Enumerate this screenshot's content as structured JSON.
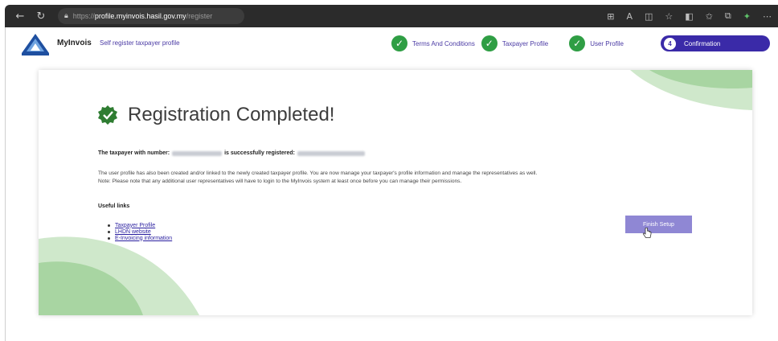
{
  "browser": {
    "url_scheme": "https://",
    "url_host": "profile.myinvois.hasil.gov.my",
    "url_path": "/register",
    "icons": [
      "back-icon",
      "refresh-icon",
      "lock-icon",
      "apps-icon",
      "read-aloud-icon",
      "split-screen-icon",
      "favorites-icon",
      "sidebar-icon",
      "favorites-bar-icon",
      "collections-icon",
      "extensions-icon",
      "more-icon"
    ]
  },
  "header": {
    "brand": "MyInvois",
    "subtitle": "Self register taxpayer profile",
    "steps": [
      {
        "label": "Terms And Conditions",
        "status": "done"
      },
      {
        "label": "Taxpayer Profile",
        "status": "done"
      },
      {
        "label": "User Profile",
        "status": "done"
      },
      {
        "number": "4",
        "label": "Confirmation",
        "status": "active"
      }
    ]
  },
  "main": {
    "title": "Registration Completed!",
    "info_prefix": "The taxpayer with number:",
    "info_middle": "is successfully registered:",
    "paragraph_1": "The user profile has also been created and/or linked to the newly created taxpayer profile. You are now manage your taxpayer's profile information and manage the representatives as well.",
    "paragraph_2": "Note: Please note that any additional user representatives will have to login to the MyInvois system at least once before you can manage their permissions.",
    "useful_links_title": "Useful links",
    "links": [
      "Taxpayer Profile",
      "LHDN website",
      "E-Invoicing information"
    ],
    "finish_button": "Finish Setup"
  },
  "colors": {
    "primary": "#3a2aa8",
    "success": "#2f9e44",
    "button": "#8f87d4",
    "deco_green": "#a8d5a2"
  }
}
